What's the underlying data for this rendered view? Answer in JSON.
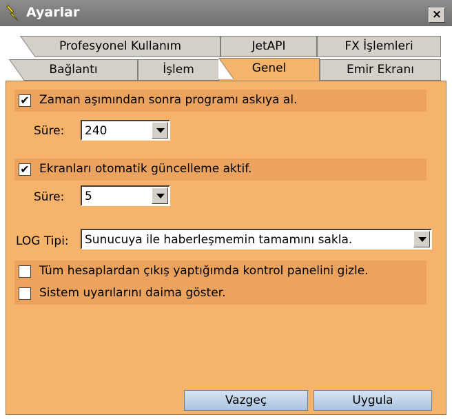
{
  "window": {
    "title": "Ayarlar",
    "close_label": "×"
  },
  "tabs": {
    "row1": [
      "Profesyonel Kullanım",
      "JetAPI",
      "FX İşlemleri"
    ],
    "row2": [
      "Bağlantı",
      "İşlem",
      "Genel",
      "Emir Ekranı"
    ],
    "active": "Genel"
  },
  "settings": {
    "timeout": {
      "checked": true,
      "label": "Zaman aşımından sonra programı askıya al.",
      "duration_label": "Süre:",
      "duration_value": "240"
    },
    "autorefresh": {
      "checked": true,
      "label": "Ekranları otomatik güncelleme aktif.",
      "duration_label": "Süre:",
      "duration_value": "5"
    },
    "log": {
      "label": "LOG Tipi:",
      "value": "Sunucuya ile haberleşmemin tamamını sakla."
    },
    "hide_panel": {
      "checked": false,
      "label": "Tüm hesaplardan çıkış yaptığımda kontrol panelini gizle."
    },
    "system_warnings": {
      "checked": false,
      "label": "Sistem uyarılarını daima göster."
    }
  },
  "buttons": {
    "cancel": "Vazgeç",
    "apply": "Uygula"
  },
  "colors": {
    "panel": "#f6b36a",
    "stripe": "#eba35d",
    "titlebar": "#7a7a7a",
    "button": "#b8cfe8"
  }
}
